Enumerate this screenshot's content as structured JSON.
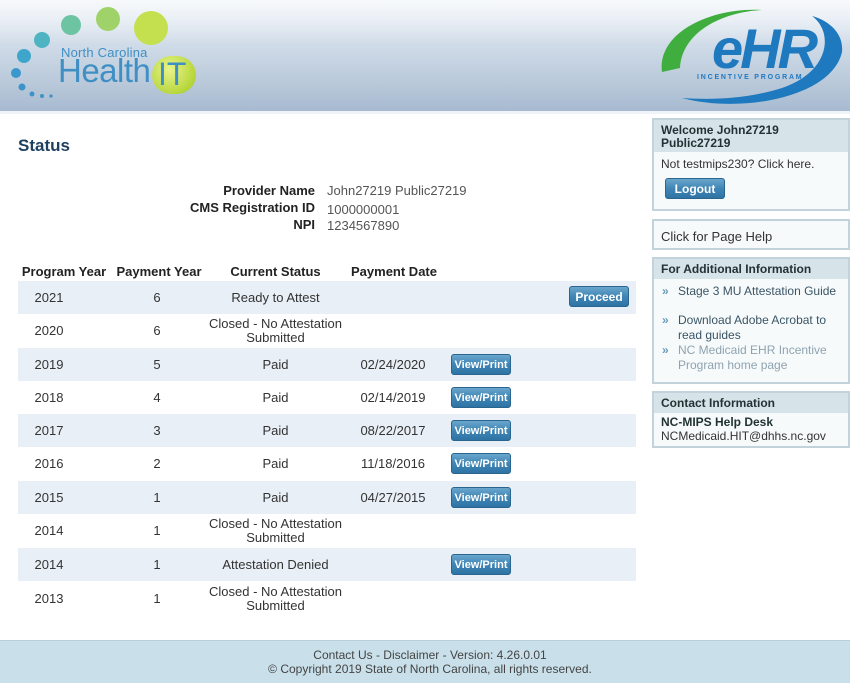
{
  "header": {
    "logo_subtitle": "North Carolina",
    "logo_main": "Health",
    "logo_it": "IT",
    "ehr_main": "eHR",
    "ehr_sub": "INCENTIVE PROGRAM"
  },
  "page_title": "Status",
  "provider": {
    "name_label": "Provider Name",
    "name_value": "John27219 Public27219",
    "cms_label": "CMS Registration ID",
    "cms_value": "1000000001",
    "npi_label": "NPI",
    "npi_value": "1234567890"
  },
  "table": {
    "columns": [
      "Program Year",
      "Payment Year",
      "Current Status",
      "Payment Date"
    ],
    "rows": [
      {
        "program_year": "2021",
        "payment_year": "6",
        "status": "Ready to Attest",
        "date": "",
        "action": "Proceed"
      },
      {
        "program_year": "2020",
        "payment_year": "6",
        "status": "Closed - No Attestation Submitted",
        "date": "",
        "action": ""
      },
      {
        "program_year": "2019",
        "payment_year": "5",
        "status": "Paid",
        "date": "02/24/2020",
        "action": "View/Print"
      },
      {
        "program_year": "2018",
        "payment_year": "4",
        "status": "Paid",
        "date": "02/14/2019",
        "action": "View/Print"
      },
      {
        "program_year": "2017",
        "payment_year": "3",
        "status": "Paid",
        "date": "08/22/2017",
        "action": "View/Print"
      },
      {
        "program_year": "2016",
        "payment_year": "2",
        "status": "Paid",
        "date": "11/18/2016",
        "action": "View/Print"
      },
      {
        "program_year": "2015",
        "payment_year": "1",
        "status": "Paid",
        "date": "04/27/2015",
        "action": "View/Print"
      },
      {
        "program_year": "2014",
        "payment_year": "1",
        "status": "Closed - No Attestation Submitted",
        "date": "",
        "action": ""
      },
      {
        "program_year": "2014",
        "payment_year": "1",
        "status": "Attestation Denied",
        "date": "",
        "action": "View/Print"
      },
      {
        "program_year": "2013",
        "payment_year": "1",
        "status": "Closed - No Attestation Submitted",
        "date": "",
        "action": ""
      }
    ]
  },
  "sidebar": {
    "welcome_title": "Welcome John27219 Public27219",
    "not_user": "Not testmips230? Click here.",
    "logout_label": "Logout",
    "page_help": "Click for Page Help",
    "additional_title": "For Additional Information",
    "links": [
      "Stage 3 MU Attestation Guide",
      "Download Adobe Acrobat to read guides",
      "NC Medicaid EHR Incentive Program home page"
    ],
    "contact_title": "Contact Information",
    "contact_name": "NC-MIPS Help Desk",
    "contact_email": "NCMedicaid.HIT@dhhs.nc.gov"
  },
  "footer": {
    "links": "Contact Us - Disclaimer - Version: 4.26.0.01",
    "copyright": "© Copyright 2019 State of North Carolina, all rights reserved."
  }
}
